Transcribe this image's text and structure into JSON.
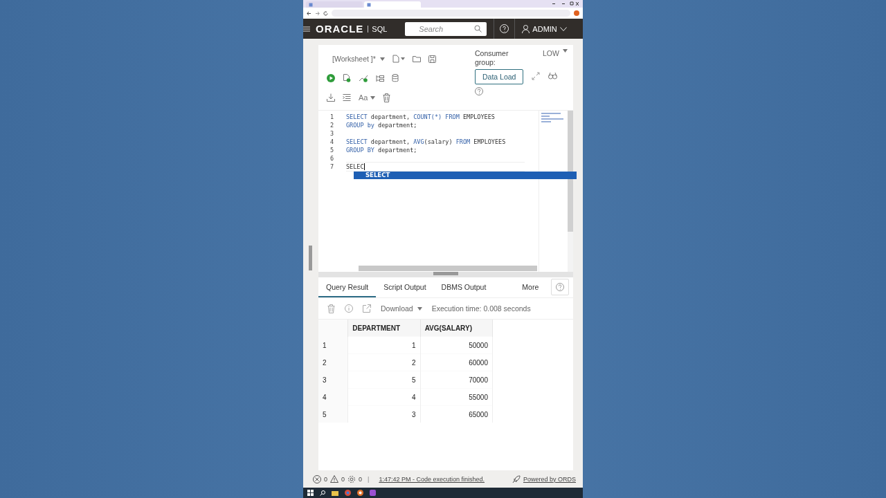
{
  "browser": {
    "tabs": [
      {
        "selected": false
      },
      {
        "selected": true
      }
    ]
  },
  "header": {
    "logo": "ORACLE",
    "product": "SQL",
    "search": {
      "placeholder": "Search"
    },
    "user": "ADMIN"
  },
  "toolbar": {
    "worksheet": "[Worksheet ]*",
    "font_button": "Aa",
    "consumer_group_label": "Consumer group:",
    "consumer_group": "LOW",
    "data_load_button": "Data Load"
  },
  "editor": {
    "lines": [
      {
        "number": "1",
        "tokens": [
          {
            "text": "SELECT",
            "kind": "keyword"
          },
          {
            "text": " department, ",
            "kind": "plain"
          },
          {
            "text": "COUNT(*) FROM",
            "kind": "keyword"
          },
          {
            "text": " EMPLOYEES",
            "kind": "plain"
          }
        ]
      },
      {
        "number": "2",
        "tokens": [
          {
            "text": "GROUP by",
            "kind": "keyword"
          },
          {
            "text": " department;",
            "kind": "plain"
          }
        ]
      },
      {
        "number": "3"
      },
      {
        "number": "4",
        "tokens": [
          {
            "text": "SELECT",
            "kind": "keyword"
          },
          {
            "text": " department, ",
            "kind": "plain"
          },
          {
            "text": "AVG",
            "kind": "keyword"
          },
          {
            "text": "(salary) ",
            "kind": "plain"
          },
          {
            "text": "FROM",
            "kind": "keyword"
          },
          {
            "text": " EMPLOYEES",
            "kind": "plain"
          }
        ]
      },
      {
        "number": "5",
        "tokens": [
          {
            "text": "GROUP BY",
            "kind": "keyword"
          },
          {
            "text": " department;",
            "kind": "plain"
          }
        ]
      },
      {
        "number": "6"
      },
      {
        "number": "7",
        "tokens": [
          {
            "text": "SELEC",
            "kind": "plain"
          }
        ],
        "cursor": true
      }
    ],
    "autocomplete": [
      {
        "label": "SELECT",
        "selected": true
      }
    ]
  },
  "results": {
    "tabs": [
      {
        "label": "Query Result",
        "selected": true
      },
      {
        "label": "Script Output",
        "selected": false
      },
      {
        "label": "DBMS Output",
        "selected": false
      },
      {
        "label": "More",
        "selected": false
      }
    ],
    "download": "Download",
    "execution_time": "Execution time: 0.008 seconds",
    "columns": [
      "DEPARTMENT",
      "AVG(SALARY)"
    ],
    "rows": [
      {
        "index": "1",
        "cells": [
          "1",
          "50000"
        ]
      },
      {
        "index": "2",
        "cells": [
          "2",
          "60000"
        ]
      },
      {
        "index": "3",
        "cells": [
          "5",
          "70000"
        ]
      },
      {
        "index": "4",
        "cells": [
          "4",
          "55000"
        ]
      },
      {
        "index": "5",
        "cells": [
          "3",
          "65000"
        ]
      }
    ]
  },
  "status": {
    "errors": "0",
    "warnings": "0",
    "info": "0",
    "separator": "|",
    "message": "1:47:42 PM - Code execution finished.",
    "powered": "Powered by ORDS"
  }
}
